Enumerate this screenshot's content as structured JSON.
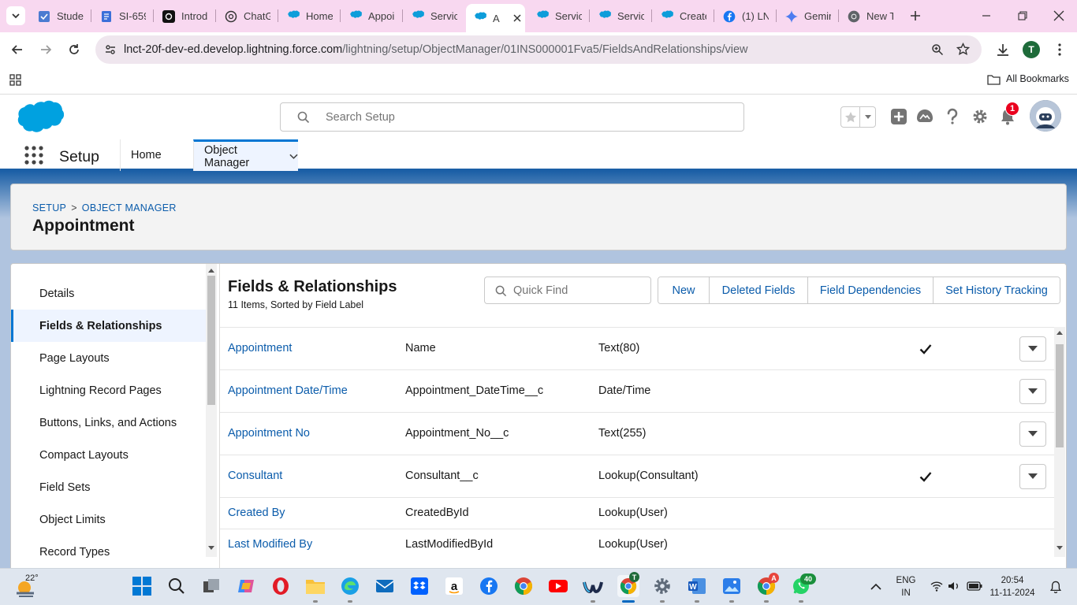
{
  "browser": {
    "tabs": [
      {
        "label": "Studen",
        "icon": "tasks-icon"
      },
      {
        "label": "SI-659",
        "icon": "doc-icon"
      },
      {
        "label": "Introd",
        "icon": "threads-icon"
      },
      {
        "label": "ChatG",
        "icon": "chatgpt-icon"
      },
      {
        "label": "Home",
        "icon": "salesforce-icon"
      },
      {
        "label": "Appoi",
        "icon": "salesforce-icon"
      },
      {
        "label": "Servic",
        "icon": "salesforce-icon"
      },
      {
        "label": "A",
        "icon": "salesforce-icon",
        "active": true
      },
      {
        "label": "Servic",
        "icon": "salesforce-icon"
      },
      {
        "label": "Servic",
        "icon": "salesforce-icon"
      },
      {
        "label": "Create",
        "icon": "salesforce-icon"
      },
      {
        "label": "(1) LN",
        "icon": "facebook-icon"
      },
      {
        "label": "Gemir",
        "icon": "gemini-icon"
      },
      {
        "label": "New T",
        "icon": "chrome-icon"
      }
    ],
    "url_host": "lnct-20f-dev-ed.develop.lightning.force.com",
    "url_path": "/lightning/setup/ObjectManager/01INS000001Fva5/FieldsAndRelationships/view",
    "profile_initial": "T",
    "all_bookmarks": "All Bookmarks"
  },
  "sf": {
    "search_placeholder": "Search Setup",
    "notification_count": "1",
    "app_name": "Setup",
    "nav": {
      "home": "Home",
      "object_manager": "Object Manager"
    },
    "breadcrumb": {
      "setup": "SETUP",
      "sep": ">",
      "object_manager": "OBJECT MANAGER"
    },
    "object_title": "Appointment",
    "left_nav": [
      "Details",
      "Fields & Relationships",
      "Page Layouts",
      "Lightning Record Pages",
      "Buttons, Links, and Actions",
      "Compact Layouts",
      "Field Sets",
      "Object Limits",
      "Record Types"
    ],
    "left_nav_active_index": 1,
    "panel": {
      "title": "Fields & Relationships",
      "subtitle": "11 Items, Sorted by Field Label",
      "quick_find_placeholder": "Quick Find",
      "buttons": [
        "New",
        "Deleted Fields",
        "Field Dependencies",
        "Set History Tracking"
      ]
    },
    "fields": [
      {
        "label": "Appointment",
        "api": "Name",
        "type": "Text(80)",
        "indexed": true,
        "menu": true
      },
      {
        "label": "Appointment Date/Time",
        "api": "Appointment_DateTime__c",
        "type": "Date/Time",
        "indexed": false,
        "menu": true
      },
      {
        "label": "Appointment No",
        "api": "Appointment_No__c",
        "type": "Text(255)",
        "indexed": false,
        "menu": true
      },
      {
        "label": "Consultant",
        "api": "Consultant__c",
        "type": "Lookup(Consultant)",
        "indexed": true,
        "menu": true
      },
      {
        "label": "Created By",
        "api": "CreatedById",
        "type": "Lookup(User)",
        "indexed": false,
        "menu": false
      },
      {
        "label": "Last Modified By",
        "api": "LastModifiedById",
        "type": "Lookup(User)",
        "indexed": false,
        "menu": false
      }
    ]
  },
  "taskbar": {
    "temperature": "22°",
    "lang_top": "ENG",
    "lang_bottom": "IN",
    "time": "20:54",
    "date": "11-11-2024",
    "whatsapp_badge": "40",
    "chrome2_badge": "A",
    "active_chrome_badge": "T"
  },
  "colors": {
    "tabstrip": "#f8d8f0",
    "sf_blue": "#0176d3",
    "link": "#0b5cab",
    "brand_band": "#1b5fa6"
  }
}
